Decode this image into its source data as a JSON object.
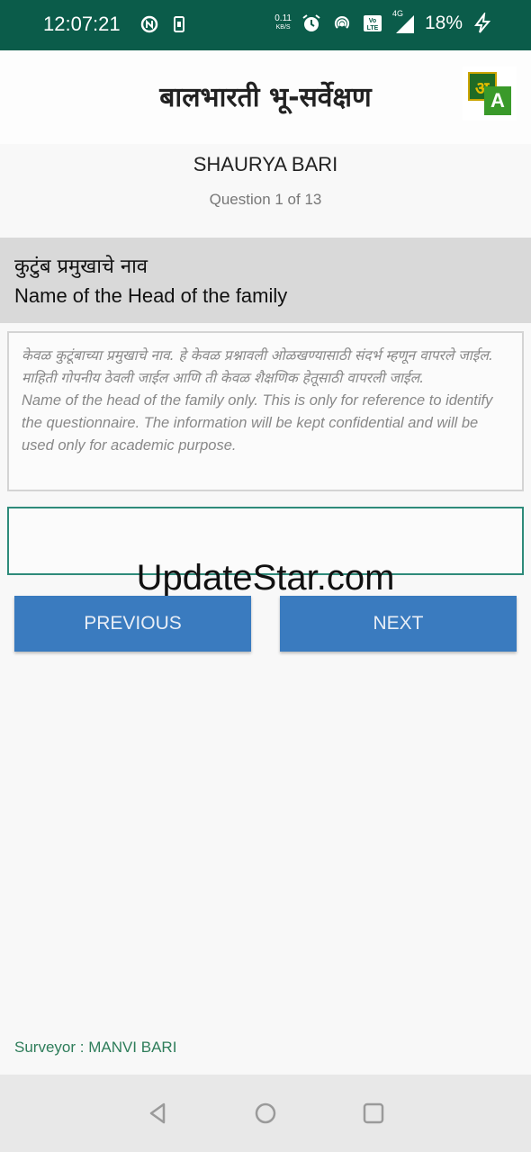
{
  "status_bar": {
    "time": "12:07:21",
    "net_speed_value": "0.11",
    "net_speed_unit": "KB/S",
    "network_type": "4G",
    "battery": "18%",
    "icons": [
      "data-saver-icon",
      "phone-icon",
      "alarm-icon",
      "hotspot-icon",
      "volte-icon",
      "signal-icon",
      "charging-icon"
    ]
  },
  "app_bar": {
    "title": "बालभारती भू-सर्वेक्षण",
    "language_icon": {
      "back_letter": "अ",
      "front_letter": "A"
    }
  },
  "respondent_name": "SHAURYA BARI",
  "progress_label": "Question 1 of 13",
  "question": {
    "title_mr": "कुटुंब प्रमुखाचे नाव",
    "title_en": "Name of the Head of the family",
    "help_mr": "केवळ कुटूंबाच्या प्रमुखाचे नाव. हे केवळ प्रश्नावली ओळखण्यासाठी संदर्भ म्हणून वापरले जाईल. माहिती गोपनीय ठेवली जाईल आणि ती केवळ शैक्षणिक हेतूसाठी वापरली जाईल.",
    "help_en": "Name of the head of the family only.  This is only for reference to identify the questionnaire. The information will be kept confidential and will be used only for academic purpose.",
    "answer_value": "",
    "answer_placeholder": ""
  },
  "watermark": "UpdateStar.com",
  "buttons": {
    "previous": "PREVIOUS",
    "next": "NEXT"
  },
  "footer": {
    "surveyor": "Surveyor : MANVI BARI"
  },
  "colors": {
    "status_bar": "#0b5c4a",
    "button": "#3a7bbf",
    "question_header": "#d9d9d9",
    "input_border": "#2e8b7a",
    "surveyor_text": "#2e7d5a"
  }
}
